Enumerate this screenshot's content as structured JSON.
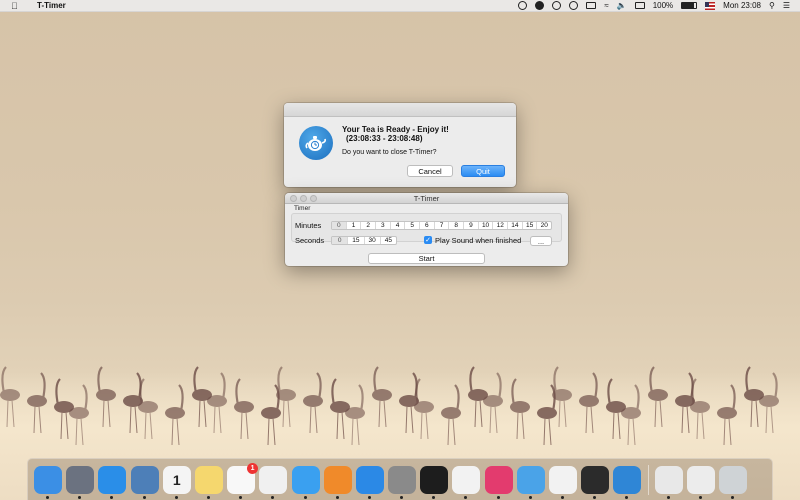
{
  "menubar": {
    "app_name": "T-Timer",
    "battery": "100%",
    "clock": "Mon 23:08"
  },
  "alert": {
    "title": "Your Tea is Ready - Enjoy it!",
    "range": "(23:08:33 - 23:08:48)",
    "message": "Do you want to close T-Timer?",
    "cancel_label": "Cancel",
    "quit_label": "Quit"
  },
  "timer": {
    "window_title": "T-Timer",
    "group_label": "Timer",
    "minutes_label": "Minutes",
    "seconds_label": "Seconds",
    "minutes": [
      "0",
      "1",
      "2",
      "3",
      "4",
      "5",
      "6",
      "7",
      "8",
      "9",
      "10",
      "12",
      "14",
      "15",
      "20"
    ],
    "seconds": [
      "0",
      "15",
      "30",
      "45"
    ],
    "play_sound_label": "Play Sound when finished",
    "play_sound_checked": true,
    "more_label": "...",
    "start_label": "Start"
  },
  "dock": {
    "items": [
      {
        "icon": "finder-icon",
        "color": "#3b8fe5"
      },
      {
        "icon": "launchpad-icon",
        "color": "#6b7280"
      },
      {
        "icon": "safari-icon",
        "color": "#2a8ee8"
      },
      {
        "icon": "preview-icon",
        "color": "#4d7fb8"
      },
      {
        "icon": "calendar-icon",
        "color": "#f4f4f4",
        "text": "1"
      },
      {
        "icon": "notes-icon",
        "color": "#f5d76e"
      },
      {
        "icon": "reminders-icon",
        "color": "#f8f8f8",
        "badge": "1"
      },
      {
        "icon": "photos-icon",
        "color": "#f0f0f0"
      },
      {
        "icon": "messages-icon",
        "color": "#3aa0f0"
      },
      {
        "icon": "ibooks-icon",
        "color": "#f08a2a"
      },
      {
        "icon": "app-store-icon",
        "color": "#2b89e6"
      },
      {
        "icon": "system-preferences-icon",
        "color": "#8a8a8a"
      },
      {
        "icon": "terminal-icon",
        "color": "#1d1d1d"
      },
      {
        "icon": "itunes-icon",
        "color": "#f2f2f2"
      },
      {
        "icon": "wunderlist-icon",
        "color": "#e33b6e"
      },
      {
        "icon": "xcode-icon",
        "color": "#4aa3e8"
      },
      {
        "icon": "chrome-icon",
        "color": "#f2f2f2"
      },
      {
        "icon": "activity-monitor-icon",
        "color": "#2b2b2b"
      },
      {
        "icon": "t-timer-icon",
        "color": "#2f86d6"
      }
    ],
    "right_items": [
      {
        "icon": "documents-stack-icon",
        "color": "#e8e8e8"
      },
      {
        "icon": "downloads-stack-icon",
        "color": "#ececec"
      },
      {
        "icon": "trash-icon",
        "color": "#cfd3d6"
      }
    ]
  }
}
